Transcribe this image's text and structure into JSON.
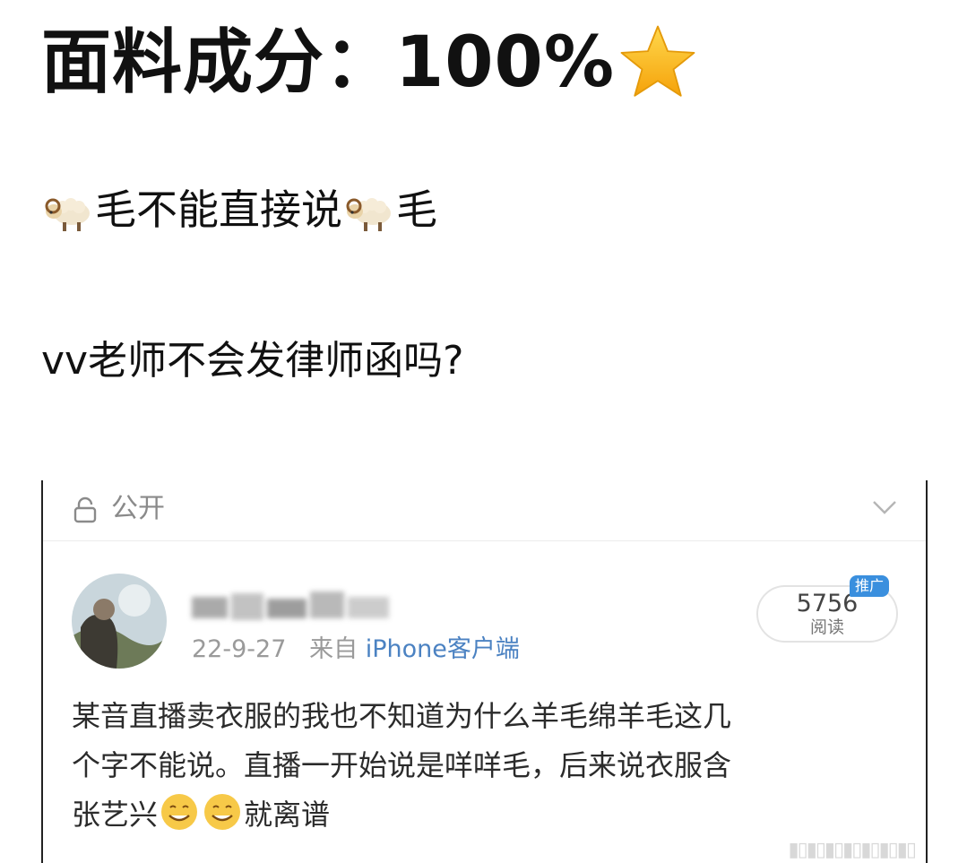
{
  "headline": {
    "text": "面料成分：100%",
    "icon": "star-icon"
  },
  "line2": {
    "part1": "毛不能直接说",
    "part2": "毛",
    "icon": "ram-icon"
  },
  "line3": {
    "text": "vv老师不会发律师函吗?"
  },
  "screenshot": {
    "visibility": "公开",
    "post": {
      "date": "22-9-27",
      "source_prefix": "来自",
      "source": "iPhone客户端",
      "read_count": "5756",
      "read_label": "阅读",
      "promo_tag": "推广",
      "lines": [
        "某音直播卖衣服的我也不知道为什么羊毛绵羊毛这几",
        "个字不能说。直播一开始说是咩咩毛，后来说衣服含",
        "张艺兴",
        "就离谱"
      ]
    }
  },
  "colors": {
    "link": "#4b82c2",
    "muted": "#9a9a9a",
    "promo": "#3a8fde",
    "star": "#f7b924"
  }
}
